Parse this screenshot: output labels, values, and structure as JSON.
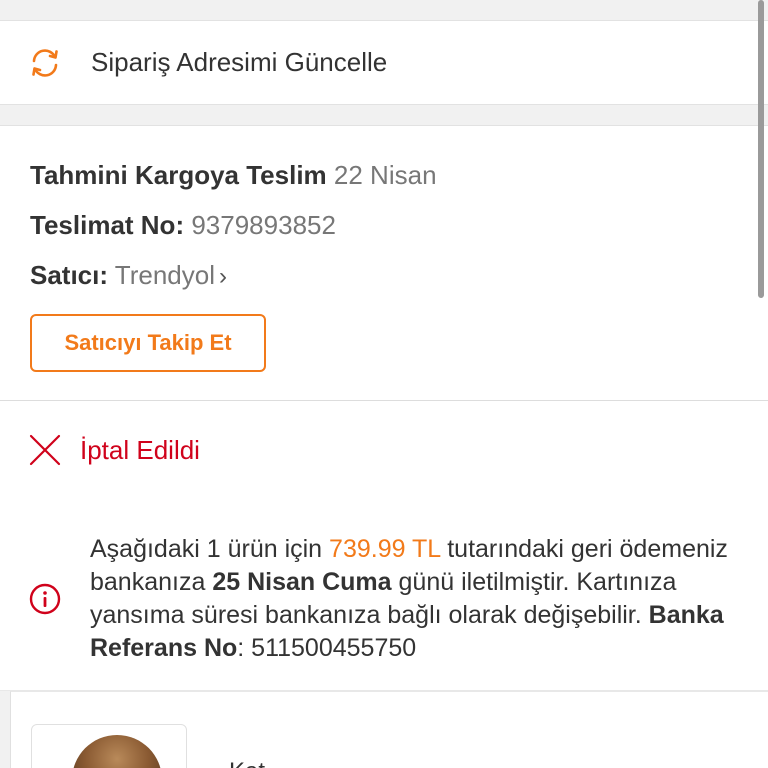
{
  "update_address": {
    "icon": "refresh-icon",
    "label": "Sipariş Adresimi Güncelle"
  },
  "shipment": {
    "estimated_label": "Tahmini Kargoya Teslim",
    "estimated_value": "22 Nisan",
    "delivery_no_label": "Teslimat No:",
    "delivery_no_value": "9379893852",
    "seller_label": "Satıcı:",
    "seller_value": "Trendyol",
    "follow_button": "Satıcıyı Takip Et"
  },
  "cancellation": {
    "icon": "close-icon",
    "status": "İptal Edildi"
  },
  "refund": {
    "icon": "info-icon",
    "text_1": "Aşağıdaki 1 ürün için",
    "amount": "739.99 TL",
    "text_2": "tutarındaki geri ödemeniz bankanıza",
    "date": "25 Nisan Cuma",
    "text_3": "günü iletilmiştir. Kartınıza yansıma süresi bankanıza bağlı olarak değişebilir.",
    "ref_label": "Banka Referans No",
    "ref_sep": ":",
    "ref_value": "511500455750"
  },
  "product": {
    "name_partial": "Kat"
  },
  "colors": {
    "accent": "#f27a1a",
    "cancel": "#d0021b",
    "text": "#333333",
    "muted": "#777777"
  }
}
